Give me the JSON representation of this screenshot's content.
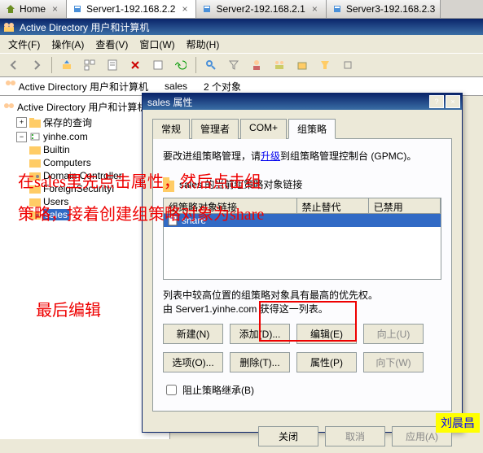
{
  "browser_tabs": [
    {
      "label": "Home",
      "icon": "home-icon",
      "active": false
    },
    {
      "label": "Server1-192.168.2.2",
      "icon": "server-icon",
      "active": true
    },
    {
      "label": "Server2-192.168.2.1",
      "icon": "server-icon",
      "active": false
    },
    {
      "label": "Server3-192.168.2.3",
      "icon": "server-icon",
      "active": false
    }
  ],
  "window_title": "Active Directory 用户和计算机",
  "menu": {
    "file": "文件(F)",
    "action": "操作(A)",
    "view": "查看(V)",
    "window": "窗口(W)",
    "help": "帮助(H)"
  },
  "subbar": {
    "root": "Active Directory 用户和计算机",
    "path": "sales",
    "count": "2 个对象"
  },
  "tree": {
    "root": "Active Directory 用户和计算机",
    "saved": "保存的查询",
    "domain": "yinhe.com",
    "children": [
      "Builtin",
      "Computers",
      "Domain Controller",
      "ForeignSecurityI",
      "Users",
      "sales"
    ]
  },
  "dialog": {
    "title": "sales 属性",
    "tabs": [
      "常规",
      "管理者",
      "COM+",
      "组策略"
    ],
    "active_tab": 3,
    "upgrade_text_pre": "要改进组策略管理，请",
    "upgrade_link": "升级",
    "upgrade_text_post": "到组策略管理控制台 (GPMC)。",
    "list_label": "sales 的当前组策略对象链接",
    "columns": [
      "组策略对象链接",
      "禁止替代",
      "已禁用"
    ],
    "rows": [
      {
        "name": "share",
        "icon": "gpo-icon"
      }
    ],
    "priority_text": "列表中较高位置的组策略对象具有最高的优先权。",
    "obtained_text": "由 Server1.yinhe.com 获得这一列表。",
    "buttons": {
      "new": "新建(N)",
      "add": "添加(D)...",
      "edit": "编辑(E)",
      "up": "向上(U)",
      "options": "选项(O)...",
      "delete": "删除(T)...",
      "properties": "属性(P)",
      "down": "向下(W)"
    },
    "block_inherit": "阻止策略继承(B)",
    "close": "关闭",
    "cancel": "取消",
    "apply": "应用(A)"
  },
  "annotations": {
    "line1": "在sales里先点击属性，然后点击组",
    "line2": "策略，接着创建组策略对象为share",
    "line3": "最后编辑"
  },
  "watermark": "刘晨昌"
}
